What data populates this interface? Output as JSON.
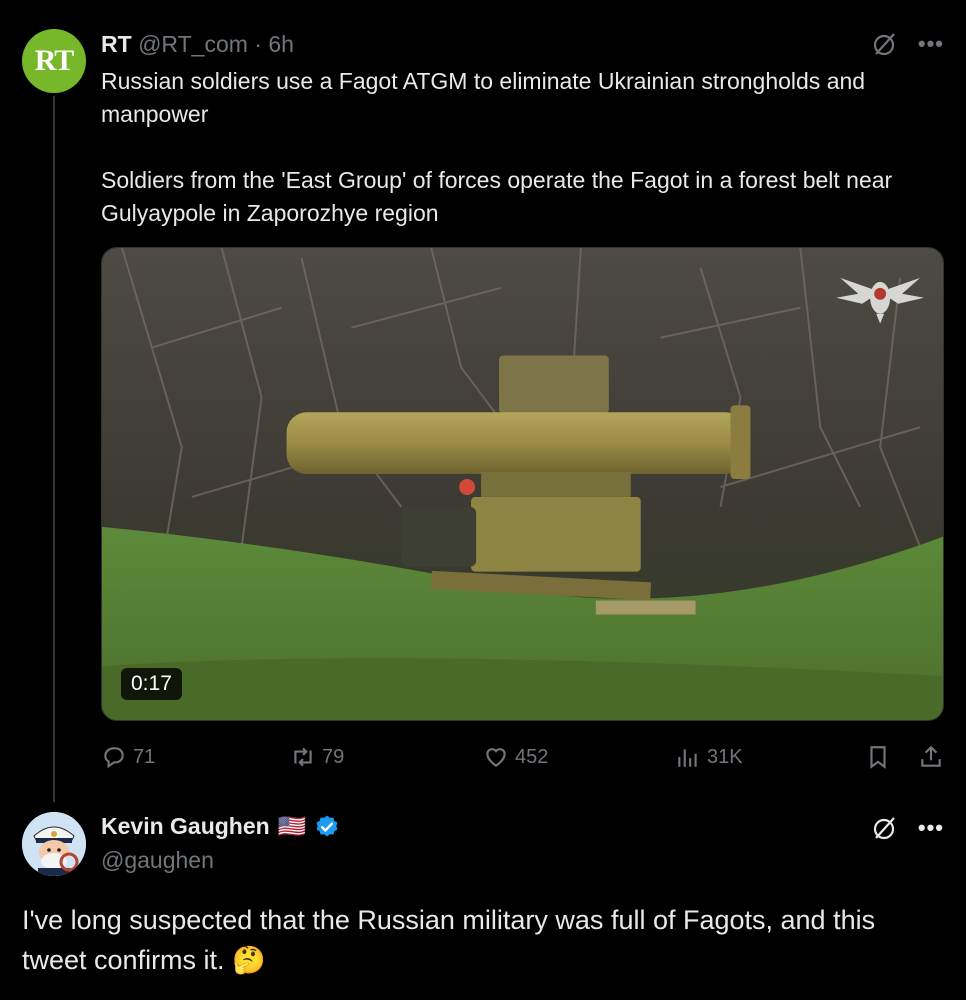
{
  "tweet": {
    "name": "RT",
    "handle": "@RT_com",
    "dot": "·",
    "time": "6h",
    "avatar_text": "RT",
    "text_p1": "Russian soldiers use a Fagot ATGM to eliminate Ukrainian strongholds and manpower",
    "text_p2": "Soldiers from the 'East Group' of forces operate the Fagot in a forest belt near Gulyaypole in Zaporozhye region",
    "video_duration": "0:17",
    "stats": {
      "replies": "71",
      "reposts": "79",
      "likes": "452",
      "views": "31K"
    }
  },
  "reply": {
    "name": "Kevin Gaughen",
    "flag": "🇺🇸",
    "handle": "@gaughen",
    "text": "I've long suspected that the Russian military was full of Fagots, and this tweet confirms it.",
    "emoji": "🤔"
  },
  "icons": {
    "grok": "grok-icon",
    "more": "more-icon",
    "reply": "reply-icon",
    "repost": "repost-icon",
    "like": "heart-icon",
    "views": "views-icon",
    "bookmark": "bookmark-icon",
    "share": "share-icon",
    "verified": "verified-badge-icon"
  },
  "colors": {
    "background": "#000000",
    "text": "#e7e9ea",
    "secondary": "#71767b",
    "rt_green": "#77b82a",
    "verified_blue": "#1d9bf0"
  }
}
